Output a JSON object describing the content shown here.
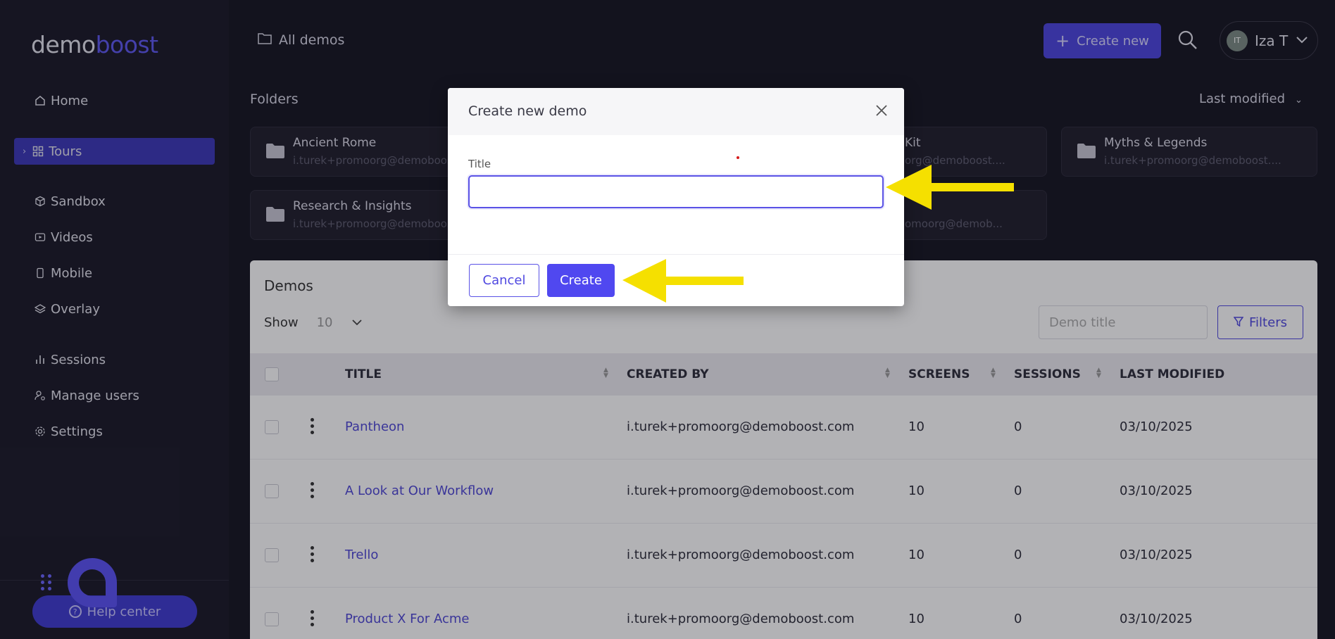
{
  "brand": {
    "part1": "demo",
    "part2": "boost"
  },
  "sidebar": {
    "items": [
      {
        "label": "Home"
      },
      {
        "label": "Tours"
      },
      {
        "label": "Sandbox"
      },
      {
        "label": "Videos"
      },
      {
        "label": "Mobile"
      },
      {
        "label": "Overlay"
      },
      {
        "label": "Sessions"
      },
      {
        "label": "Manage users"
      },
      {
        "label": "Settings"
      }
    ],
    "help_label": "Help center"
  },
  "header": {
    "breadcrumb": "All demos",
    "create_new_label": "Create new",
    "user_initials": "IT",
    "user_name": "Iza T"
  },
  "folders": {
    "label": "Folders",
    "sort_label": "Last modified",
    "items": [
      {
        "name": "Ancient Rome",
        "owner": "i.turek+promoorg@demoboost.com"
      },
      {
        "name": "Kit",
        "owner": "org@demoboost...."
      },
      {
        "name": "Myths & Legends",
        "owner": "i.turek+promoorg@demoboost...."
      },
      {
        "name": "Research & Insights",
        "owner": "i.turek+promoorg@demoboost.com"
      },
      {
        "name": "",
        "owner": "omoorg@demob..."
      }
    ]
  },
  "demos": {
    "title": "Demos",
    "show_label": "Show",
    "show_value": "10",
    "search_placeholder": "Demo title",
    "filters_label": "Filters",
    "columns": [
      "TITLE",
      "CREATED BY",
      "SCREENS",
      "SESSIONS",
      "LAST MODIFIED"
    ],
    "rows": [
      {
        "title": "Pantheon",
        "created_by": "i.turek+promoorg@demoboost.com",
        "screens": "10",
        "sessions": "0",
        "modified": "03/10/2025"
      },
      {
        "title": "A Look at Our Workflow",
        "created_by": "i.turek+promoorg@demoboost.com",
        "screens": "10",
        "sessions": "0",
        "modified": "03/10/2025"
      },
      {
        "title": "Trello",
        "created_by": "i.turek+promoorg@demoboost.com",
        "screens": "10",
        "sessions": "0",
        "modified": "03/10/2025"
      },
      {
        "title": "Product X For Acme",
        "created_by": "i.turek+promoorg@demoboost.com",
        "screens": "10",
        "sessions": "0",
        "modified": "03/10/2025"
      }
    ]
  },
  "modal": {
    "title": "Create new demo",
    "field_label": "Title",
    "field_value": "",
    "cancel_label": "Cancel",
    "create_label": "Create"
  },
  "colors": {
    "accent": "#5048f0",
    "annotation_arrow": "#f5e000",
    "sidebar_bg": "#1a1927"
  },
  "icons": {
    "home": "home-icon",
    "tours": "grid-icon",
    "sandbox": "cube-icon",
    "videos": "video-icon",
    "mobile": "mobile-icon",
    "overlay": "layers-icon",
    "sessions": "bar-chart-icon",
    "manage_users": "user-gear-icon",
    "settings": "gear-icon"
  }
}
